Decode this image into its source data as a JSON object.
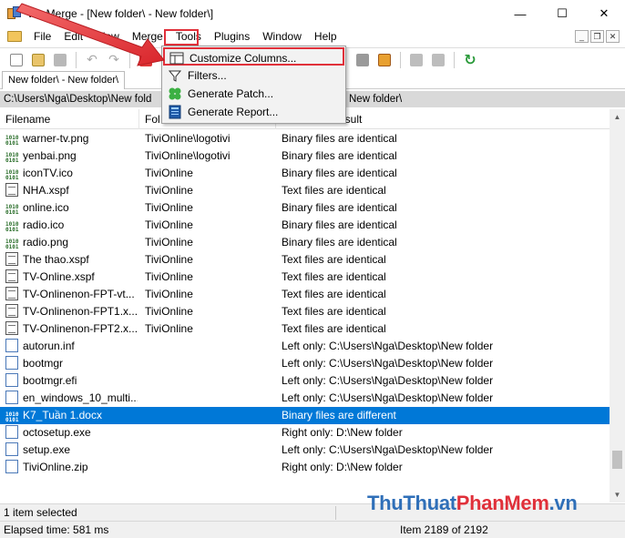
{
  "window": {
    "title": "WinMerge - [New folder\\ - New folder\\]",
    "controls": [
      "minimize",
      "maximize",
      "close"
    ]
  },
  "menubar": {
    "items": [
      "File",
      "Edit",
      "View",
      "Merge",
      "Tools",
      "Plugins",
      "Window",
      "Help"
    ]
  },
  "tools_menu": {
    "items": [
      {
        "label": "Customize Columns...",
        "icon": "columns-icon",
        "highlighted": true
      },
      {
        "label": "Filters...",
        "icon": "filter-icon"
      },
      {
        "label": "Generate Patch...",
        "icon": "patch-icon"
      },
      {
        "label": "Generate Report...",
        "icon": "report-icon"
      }
    ]
  },
  "tabs": [
    "New folder\\ - New folder\\"
  ],
  "paths": {
    "left": "C:\\Users\\Nga\\Desktop\\New fold",
    "right": "New folder\\"
  },
  "columns": [
    "Filename",
    "Fol",
    "esult"
  ],
  "rows": [
    {
      "name": "warner-tv.png",
      "folder": "TiviOnline\\logotivi",
      "result": "Binary files are identical",
      "icon": "bin"
    },
    {
      "name": "yenbai.png",
      "folder": "TiviOnline\\logotivi",
      "result": "Binary files are identical",
      "icon": "bin"
    },
    {
      "name": "iconTV.ico",
      "folder": "TiviOnline",
      "result": "Binary files are identical",
      "icon": "bin"
    },
    {
      "name": "NHA.xspf",
      "folder": "TiviOnline",
      "result": "Text files are identical",
      "icon": "txt"
    },
    {
      "name": "online.ico",
      "folder": "TiviOnline",
      "result": "Binary files are identical",
      "icon": "bin"
    },
    {
      "name": "radio.ico",
      "folder": "TiviOnline",
      "result": "Binary files are identical",
      "icon": "bin"
    },
    {
      "name": "radio.png",
      "folder": "TiviOnline",
      "result": "Binary files are identical",
      "icon": "bin"
    },
    {
      "name": "The thao.xspf",
      "folder": "TiviOnline",
      "result": "Text files are identical",
      "icon": "txt"
    },
    {
      "name": "TV-Online.xspf",
      "folder": "TiviOnline",
      "result": "Text files are identical",
      "icon": "txt"
    },
    {
      "name": "TV-Onlinenon-FPT-vt...",
      "folder": "TiviOnline",
      "result": "Text files are identical",
      "icon": "txt"
    },
    {
      "name": "TV-Onlinenon-FPT1.x...",
      "folder": "TiviOnline",
      "result": "Text files are identical",
      "icon": "txt"
    },
    {
      "name": "TV-Onlinenon-FPT2.x...",
      "folder": "TiviOnline",
      "result": "Text files are identical",
      "icon": "txt"
    },
    {
      "name": "autorun.inf",
      "folder": "",
      "result": "Left only: C:\\Users\\Nga\\Desktop\\New folder",
      "icon": "blank"
    },
    {
      "name": "bootmgr",
      "folder": "",
      "result": "Left only: C:\\Users\\Nga\\Desktop\\New folder",
      "icon": "blank"
    },
    {
      "name": "bootmgr.efi",
      "folder": "",
      "result": "Left only: C:\\Users\\Nga\\Desktop\\New folder",
      "icon": "blank"
    },
    {
      "name": "en_windows_10_multi...",
      "folder": "",
      "result": "Left only: C:\\Users\\Nga\\Desktop\\New folder",
      "icon": "blank"
    },
    {
      "name": "K7_Tuần 1.docx",
      "folder": "",
      "result": "Binary files are different",
      "icon": "bin",
      "selected": true
    },
    {
      "name": "octosetup.exe",
      "folder": "",
      "result": "Right only: D:\\New folder",
      "icon": "blank"
    },
    {
      "name": "setup.exe",
      "folder": "",
      "result": "Left only: C:\\Users\\Nga\\Desktop\\New folder",
      "icon": "blank"
    },
    {
      "name": "TiviOnline.zip",
      "folder": "",
      "result": "Right only: D:\\New folder",
      "icon": "blank"
    }
  ],
  "status": {
    "selection": "1 item selected",
    "elapsed": "Elapsed time: 581 ms",
    "item_position": "Item 2189 of 2192"
  },
  "watermark": {
    "part1": "ThuThuat",
    "part2": "PhanMem",
    "part3": ".vn"
  },
  "colors": {
    "selection": "#0078d7",
    "highlight_box": "#e0303a",
    "path_bar": "#d9d9d9"
  }
}
